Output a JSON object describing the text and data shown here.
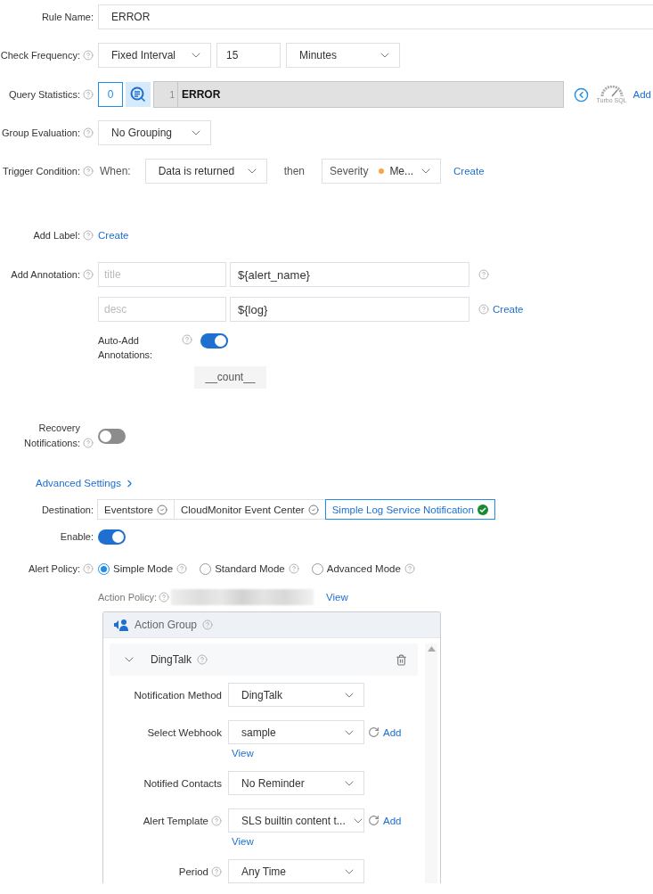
{
  "rule_name": {
    "label": "Rule Name:",
    "help": false,
    "value": "ERROR"
  },
  "check_frequency": {
    "label": "Check Frequency:",
    "help": true,
    "mode": "Fixed Interval",
    "interval": "15",
    "unit": "Minutes"
  },
  "query_statistics": {
    "label": "Query Statistics:",
    "help": true,
    "index": "0",
    "line_number": "1",
    "query": "ERROR",
    "gauge_caption": "Turbo SQL",
    "add": "Add"
  },
  "group_evaluation": {
    "label": "Group Evaluation:",
    "help": true,
    "value": "No Grouping"
  },
  "trigger_condition": {
    "label": "Trigger Condition:",
    "help": true,
    "when_label": "When:",
    "when": "Data is returned",
    "then_label": "then",
    "severity_label": "Severity",
    "severity": "Me...",
    "create": "Create"
  },
  "add_label": {
    "label": "Add Label:",
    "help": true,
    "create": "Create"
  },
  "annotations": {
    "label": "Add Annotation:",
    "help": true,
    "rows": [
      {
        "key_placeholder": "title",
        "value": "${alert_name}"
      },
      {
        "key_placeholder": "desc",
        "value": "${log}",
        "create": "Create"
      }
    ],
    "auto_add": {
      "label": "Auto-Add Annotations:",
      "on": true,
      "tags": [
        "__count__"
      ]
    }
  },
  "recovery_notifications": {
    "label": "Recovery Notifications:",
    "help": true,
    "on": false
  },
  "advanced_settings": "Advanced Settings",
  "destination": {
    "label": "Destination:",
    "options": [
      {
        "label": "Eventstore",
        "selected": false
      },
      {
        "label": "CloudMonitor Event Center",
        "selected": false
      },
      {
        "label": "Simple Log Service Notification",
        "selected": true
      }
    ]
  },
  "enable": {
    "label": "Enable:",
    "on": true
  },
  "alert_policy": {
    "label": "Alert Policy:",
    "help": true,
    "modes": [
      {
        "label": "Simple Mode",
        "selected": true
      },
      {
        "label": "Standard Mode",
        "selected": false
      },
      {
        "label": "Advanced Mode",
        "selected": false
      }
    ]
  },
  "action_policy": {
    "label": "Action Policy:",
    "view": "View"
  },
  "action_group": {
    "title": "Action Group",
    "channel": {
      "name": "DingTalk",
      "expanded": true,
      "fields": [
        {
          "label": "Notification Method",
          "help": false,
          "value": "DingTalk"
        },
        {
          "label": "Select Webhook",
          "help": false,
          "value": "sample",
          "add": "Add",
          "view": "View"
        },
        {
          "label": "Notified Contacts",
          "help": false,
          "value": "No Reminder"
        },
        {
          "label": "Alert Template",
          "help": true,
          "value": "SLS builtin content t...",
          "add": "Add",
          "view": "View"
        },
        {
          "label": "Period",
          "help": true,
          "value": "Any Time"
        }
      ]
    }
  }
}
